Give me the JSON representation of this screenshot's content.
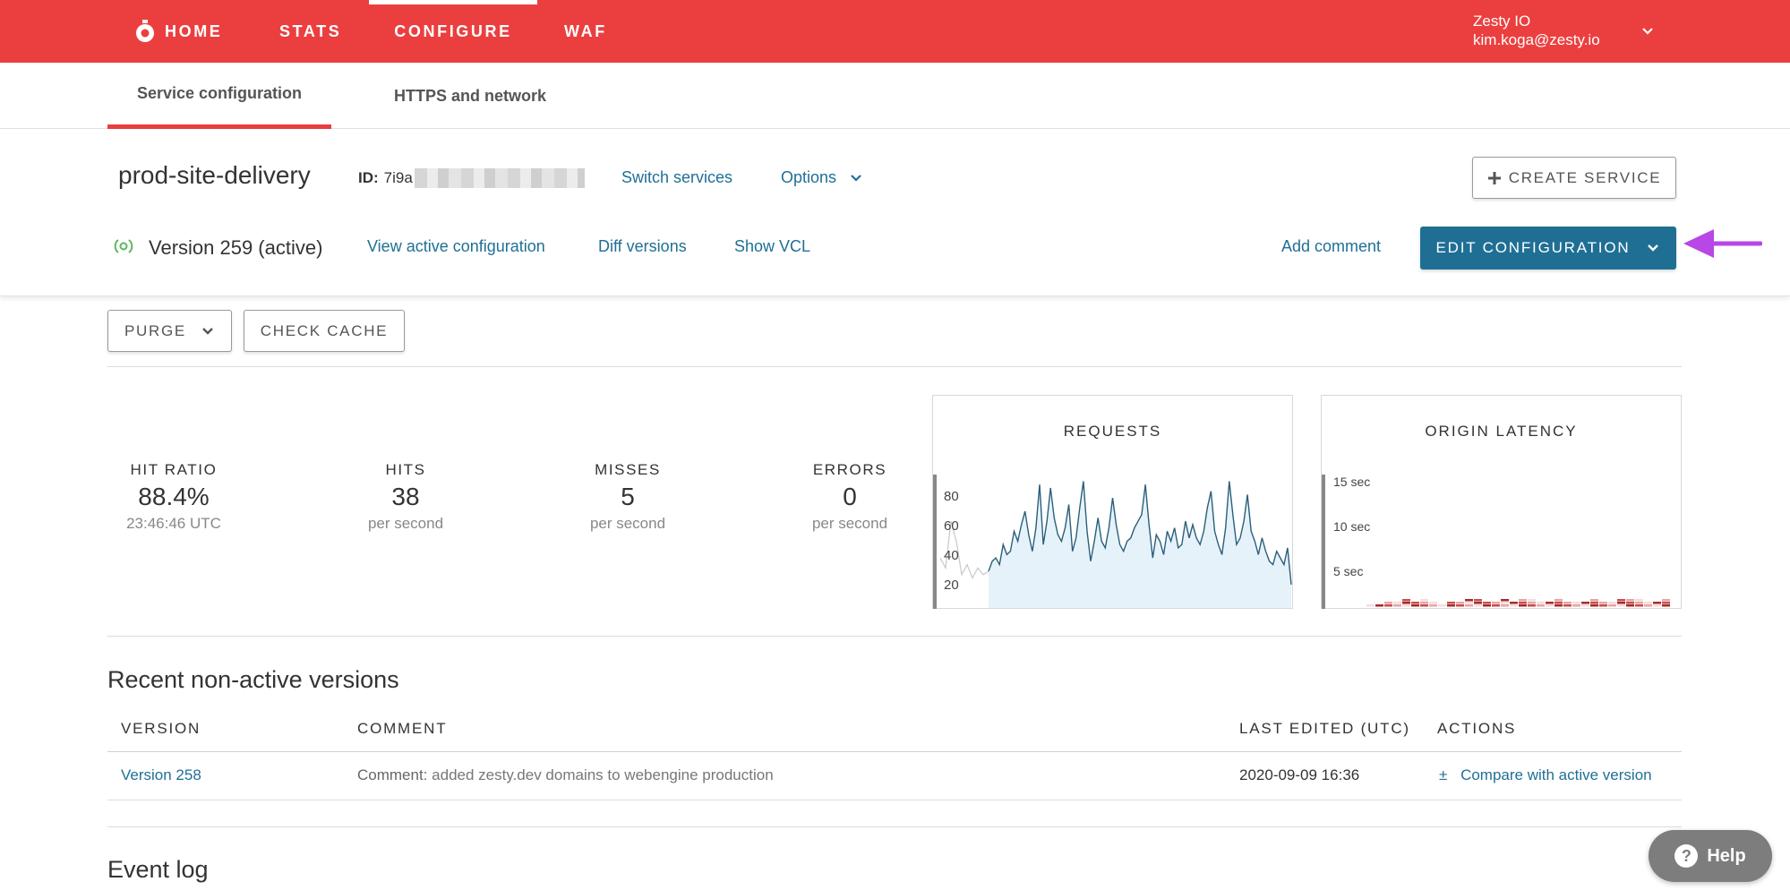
{
  "nav": {
    "items": [
      {
        "label": "HOME"
      },
      {
        "label": "STATS"
      },
      {
        "label": "CONFIGURE"
      },
      {
        "label": "WAF"
      }
    ],
    "user": {
      "name": "Zesty IO",
      "email": "kim.koga@zesty.io"
    }
  },
  "subtabs": [
    {
      "label": "Service configuration"
    },
    {
      "label": "HTTPS and network"
    }
  ],
  "service": {
    "name": "prod-site-delivery",
    "id_label": "ID:",
    "id_value": "7i9a",
    "switch_label": "Switch services",
    "options_label": "Options",
    "create_label": "CREATE SERVICE",
    "version_label": "Version 259 (active)",
    "view_active_label": "View active configuration",
    "diff_label": "Diff versions",
    "show_vcl_label": "Show VCL",
    "add_comment_label": "Add comment",
    "edit_label": "EDIT CONFIGURATION"
  },
  "actions": {
    "purge_label": "PURGE",
    "check_cache_label": "CHECK CACHE"
  },
  "stats": [
    {
      "label": "HIT RATIO",
      "value": "88.4%",
      "sub": "23:46:46 UTC"
    },
    {
      "label": "HITS",
      "value": "38",
      "sub": "per second"
    },
    {
      "label": "MISSES",
      "value": "5",
      "sub": "per second"
    },
    {
      "label": "ERRORS",
      "value": "0",
      "sub": "per second"
    }
  ],
  "chart_data": [
    {
      "type": "area",
      "title": "REQUESTS",
      "yticks": [
        "80",
        "60",
        "40",
        "20"
      ],
      "ylim": [
        10,
        90
      ],
      "values": [
        32,
        38,
        40,
        36,
        48,
        42,
        44,
        56,
        50,
        60,
        68,
        54,
        44,
        58,
        84,
        48,
        62,
        82,
        64,
        54,
        50,
        58,
        72,
        44,
        52,
        70,
        86,
        56,
        38,
        50,
        64,
        50,
        46,
        58,
        76,
        60,
        48,
        44,
        50,
        52,
        58,
        62,
        66,
        84,
        60,
        40,
        54,
        50,
        42,
        56,
        50,
        58,
        46,
        48,
        62,
        52,
        60,
        52,
        48,
        56,
        70,
        80,
        56,
        48,
        42,
        58,
        86,
        66,
        48,
        52,
        62,
        78,
        56,
        50,
        42,
        52,
        44,
        38,
        36,
        44,
        40,
        36,
        46,
        24
      ],
      "grid": false
    },
    {
      "type": "heatmap",
      "title": "ORIGIN LATENCY",
      "yticks": [
        "15 sec",
        "10 sec",
        "5 sec"
      ],
      "grid": false
    }
  ],
  "recent": {
    "title": "Recent non-active versions",
    "headers": [
      "VERSION",
      "COMMENT",
      "LAST EDITED (UTC)",
      "ACTIONS"
    ],
    "rows": [
      {
        "version": "Version 258",
        "comment_label": "Comment:",
        "comment": "added zesty.dev domains to webengine production",
        "edited": "2020-09-09 16:36",
        "action_symbol": "±",
        "action": "Compare with active version"
      }
    ]
  },
  "event_log": {
    "title": "Event log"
  },
  "help": {
    "label": "Help",
    "icon": "?"
  },
  "colors": {
    "brand": "#eb3f3f",
    "primary": "#1f6f95",
    "annotation": "#b847e5"
  }
}
